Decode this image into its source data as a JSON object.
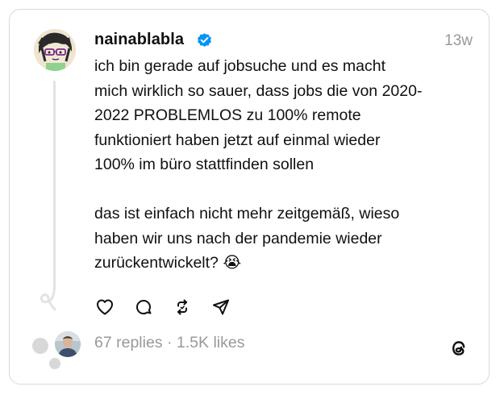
{
  "post": {
    "username": "nainablabla",
    "timestamp": "13w",
    "text": "ich bin gerade auf jobsuche und es macht\nmich wirklich so sauer, dass jobs die von 2020-\n2022 PROBLEMLOS zu 100% remote\nfunktioniert haben jetzt auf einmal wieder\n100% im büro stattfinden sollen\n\ndas ist einfach nicht mehr zeitgemäß, wieso\nhaben wir uns nach der pandemie wieder\nzurückentwickelt? 😭",
    "verified": true
  },
  "actions": {
    "icons": [
      "heart-icon",
      "comment-icon",
      "repost-icon",
      "share-icon"
    ]
  },
  "stats": {
    "replies": "67 replies",
    "separator": "·",
    "likes": "1.5K likes"
  },
  "colors": {
    "text": "#101010",
    "muted": "#999999",
    "verified": "#0095f6",
    "border": "#d9d9d9"
  }
}
